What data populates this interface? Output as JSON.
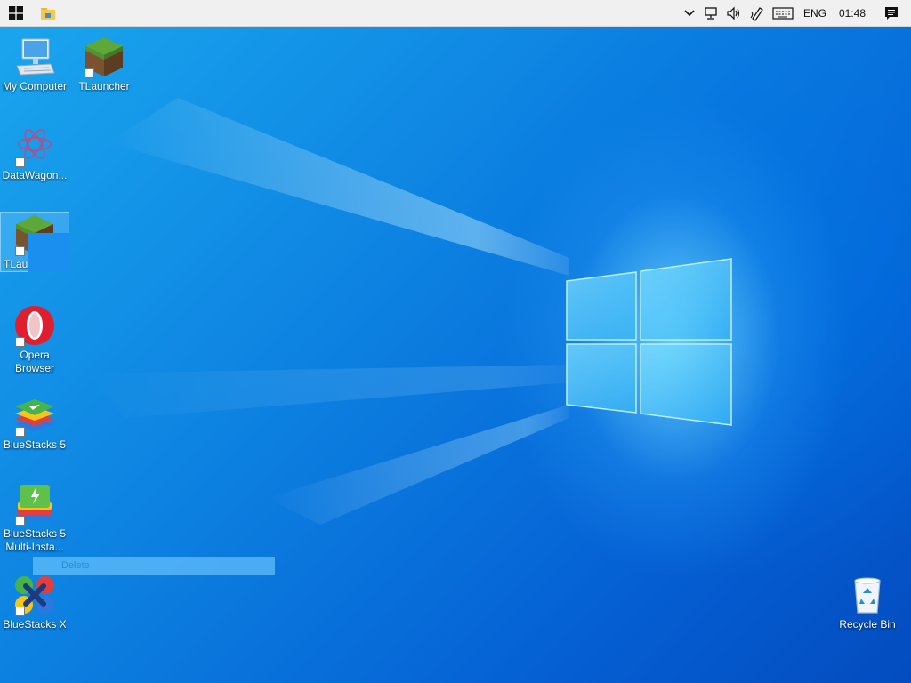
{
  "taskbar": {
    "start_icon": "windows-logo-icon",
    "explorer_icon": "file-explorer-icon",
    "tray": {
      "chevron_icon": "chevron-down-icon",
      "network_icon": "network-icon",
      "volume_icon": "volume-icon",
      "pen_icon": "pen-icon",
      "keyboard_icon": "keyboard-icon",
      "language": "ENG",
      "time": "01:48",
      "notifications_icon": "action-center-icon"
    }
  },
  "desktop": {
    "icons": [
      {
        "label": "My Computer",
        "icon": "computer-icon"
      },
      {
        "label": "TLauncher",
        "icon": "grass-block-icon"
      },
      {
        "label": "DataWagon...",
        "icon": "datawagon-icon"
      },
      {
        "label": "TLaun",
        "icon": "grass-block-icon"
      },
      {
        "label": "Opera\nBrowser",
        "icon": "opera-icon"
      },
      {
        "label": "BlueStacks 5",
        "icon": "bluestacks-icon"
      },
      {
        "label": "BlueStacks 5\nMulti-Insta...",
        "icon": "bluestacks-multi-icon"
      },
      {
        "label": "BlueStacks X",
        "icon": "bluestacks-x-icon"
      },
      {
        "label": "Recycle Bin",
        "icon": "recycle-bin-icon"
      }
    ],
    "context_menu": {
      "delete_label": "Delete"
    }
  },
  "colors": {
    "accent_light": "#8fe4ff",
    "desktop_blue": "#0c7fe0",
    "taskbar_bg": "#f0f0f0"
  }
}
